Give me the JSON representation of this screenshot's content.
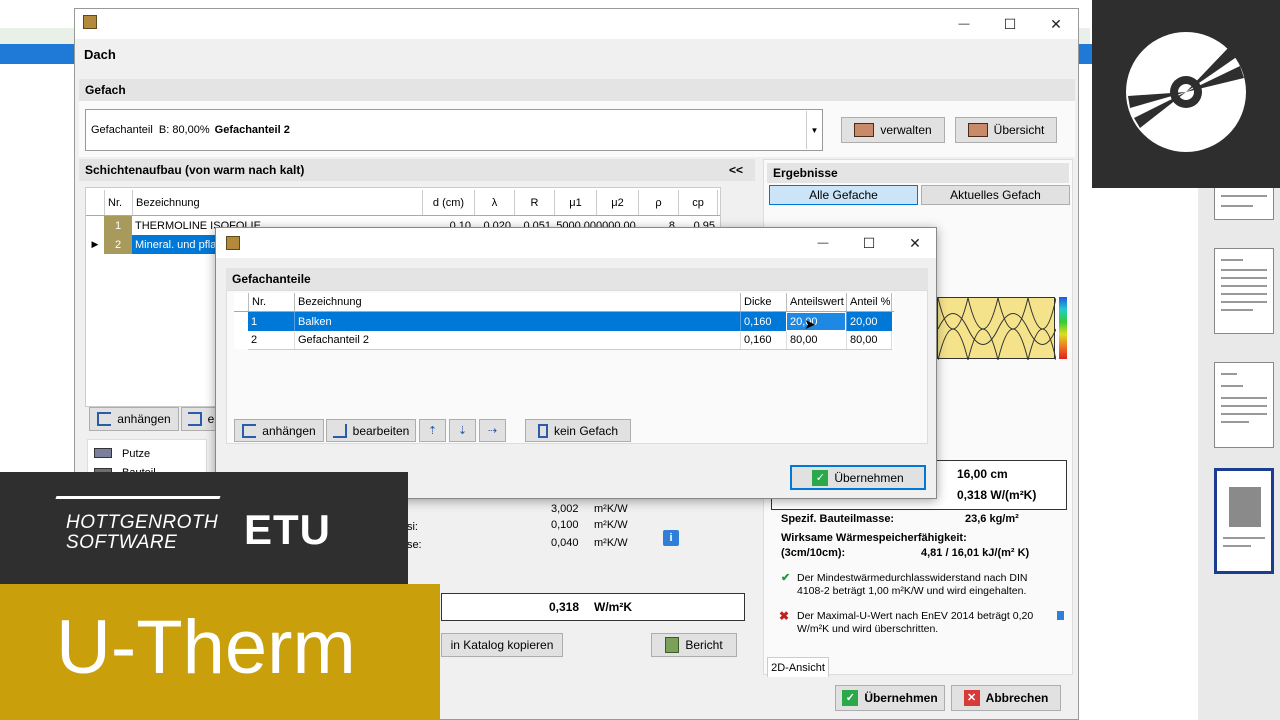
{
  "colors": {
    "brand_gold": "#c9a00c",
    "overlay_dark": "#2f2f2f",
    "selection": "#0078d7",
    "accent_blue": "#2f7fd8"
  },
  "main_window": {
    "title": "Dach",
    "close": "✕",
    "maximize": "☐",
    "minimize": "—"
  },
  "gefach": {
    "header": "Gefach",
    "select_prefix": "Gefachanteil  B: 80,00%",
    "select_value": "Gefachanteil 2",
    "btn_manage": "verwalten",
    "btn_overview": "Übersicht"
  },
  "layers": {
    "header": "Schichtenaufbau (von warm nach kalt)",
    "collapse": "<<",
    "columns": [
      "Nr.",
      "Bezeichnung",
      "d (cm)",
      "λ",
      "R",
      "μ1",
      "μ2",
      "ρ",
      "cp"
    ],
    "rows": [
      {
        "nr": "1",
        "name": "THERMOLINE ISOFOLIE",
        "d": "0,10",
        "lambda": "0,020",
        "r": "0,051",
        "mu1": "5000,00",
        "mu2": "0000,00",
        "rho": "8",
        "cp": "0,95"
      },
      {
        "nr": "2",
        "name": "Mineral. und pflan",
        "d": "",
        "lambda": "",
        "r": "",
        "mu1": "",
        "mu2": "",
        "rho": "",
        "cp": ""
      }
    ],
    "btn_append": "anhängen",
    "btn_insert": "e",
    "legend": [
      {
        "label": "Putze",
        "color": "#7a7f9e"
      },
      {
        "label": "Bauteil",
        "color": "#6f6f6f"
      }
    ]
  },
  "values": {
    "r_total": "3,002",
    "rsi": "0,100",
    "rse": "0,040",
    "unit_rk": "m²K/W",
    "label_rsi": "Rsi:",
    "label_rse": "Rse:",
    "u_value": "0,318",
    "u_unit": "W/m²K"
  },
  "bottom_buttons": {
    "copy_catalog": "in Katalog kopieren",
    "report": "Bericht"
  },
  "results": {
    "header": "Ergebnisse",
    "tab_all": "Alle Gefache",
    "tab_current": "Aktuelles Gefach",
    "thickness": "16,00 cm",
    "u": "0,318 W/(m²K)",
    "mass_label": "Spezif. Bauteilmasse:",
    "mass_value": "23,6 kg/m²",
    "storage_label1": "Wirksame Wärmespeicherfähigkeit:",
    "storage_label2": "(3cm/10cm):",
    "storage_value": "4,81 / 16,01 kJ/(m² K)",
    "check_ok": "Der Mindestwärmedurchlasswiderstand nach DIN 4108-2 beträgt 1,00 m²K/W und wird eingehalten.",
    "check_fail": "Der Maximal-U-Wert nach EnEV 2014 beträgt 0,20 W/m²K und wird überschritten.",
    "view_tab": "2D-Ansicht"
  },
  "footer": {
    "accept": "Übernehmen",
    "cancel": "Abbrechen"
  },
  "dialog": {
    "header": "Gefachanteile",
    "columns": [
      "Nr.",
      "Bezeichnung",
      "Dicke",
      "Anteilswert",
      "Anteil %"
    ],
    "rows": [
      {
        "nr": "1",
        "name": "Balken",
        "dicke": "0,160",
        "wert": "20,00",
        "anteil": "20,00"
      },
      {
        "nr": "2",
        "name": "Gefachanteil 2",
        "dicke": "0,160",
        "wert": "80,00",
        "anteil": "80,00"
      }
    ],
    "btn_append": "anhängen",
    "btn_edit": "bearbeiten",
    "btn_no_gefach": "kein Gefach",
    "btn_accept": "Übernehmen"
  },
  "branding": {
    "company_line1": "HOTTGENROTH",
    "company_line2": "SOFTWARE",
    "etu": "ETU",
    "product": "U-Therm"
  }
}
